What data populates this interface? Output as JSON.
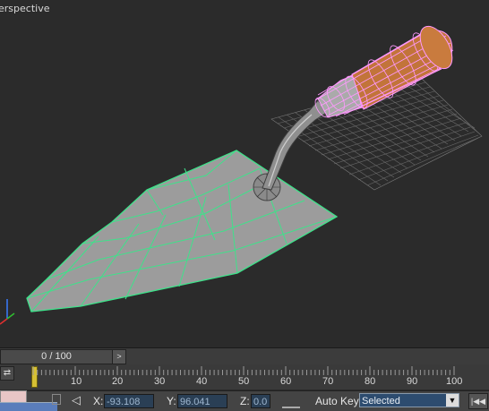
{
  "viewport": {
    "label": "erspective"
  },
  "timeslider": {
    "position": "0 / 100",
    "next_symbol": ">"
  },
  "trackbar": {
    "icon_symbol": "⇄",
    "ticks": [
      "10",
      "20",
      "30",
      "40",
      "50",
      "60",
      "70",
      "80",
      "90",
      "100"
    ]
  },
  "status": {
    "x_label": "X:",
    "x_value": "-93.108",
    "y_label": "Y:",
    "y_value": "96.041",
    "z_label": "Z:",
    "z_value": "0.0",
    "autokey_label": "Auto Key",
    "selection_filter": "Selected",
    "dropdown_symbol": "▼",
    "prev_key_symbol": "|◀◀"
  },
  "colors": {
    "viewport_bg": "#2b2b2b",
    "mesh_grey": "#9c9c9c",
    "wire_green": "#3ee28a",
    "handle_wood": "#c2743a",
    "wire_pink": "#ff99ff",
    "dropdown_bg": "#2d4c6f"
  }
}
